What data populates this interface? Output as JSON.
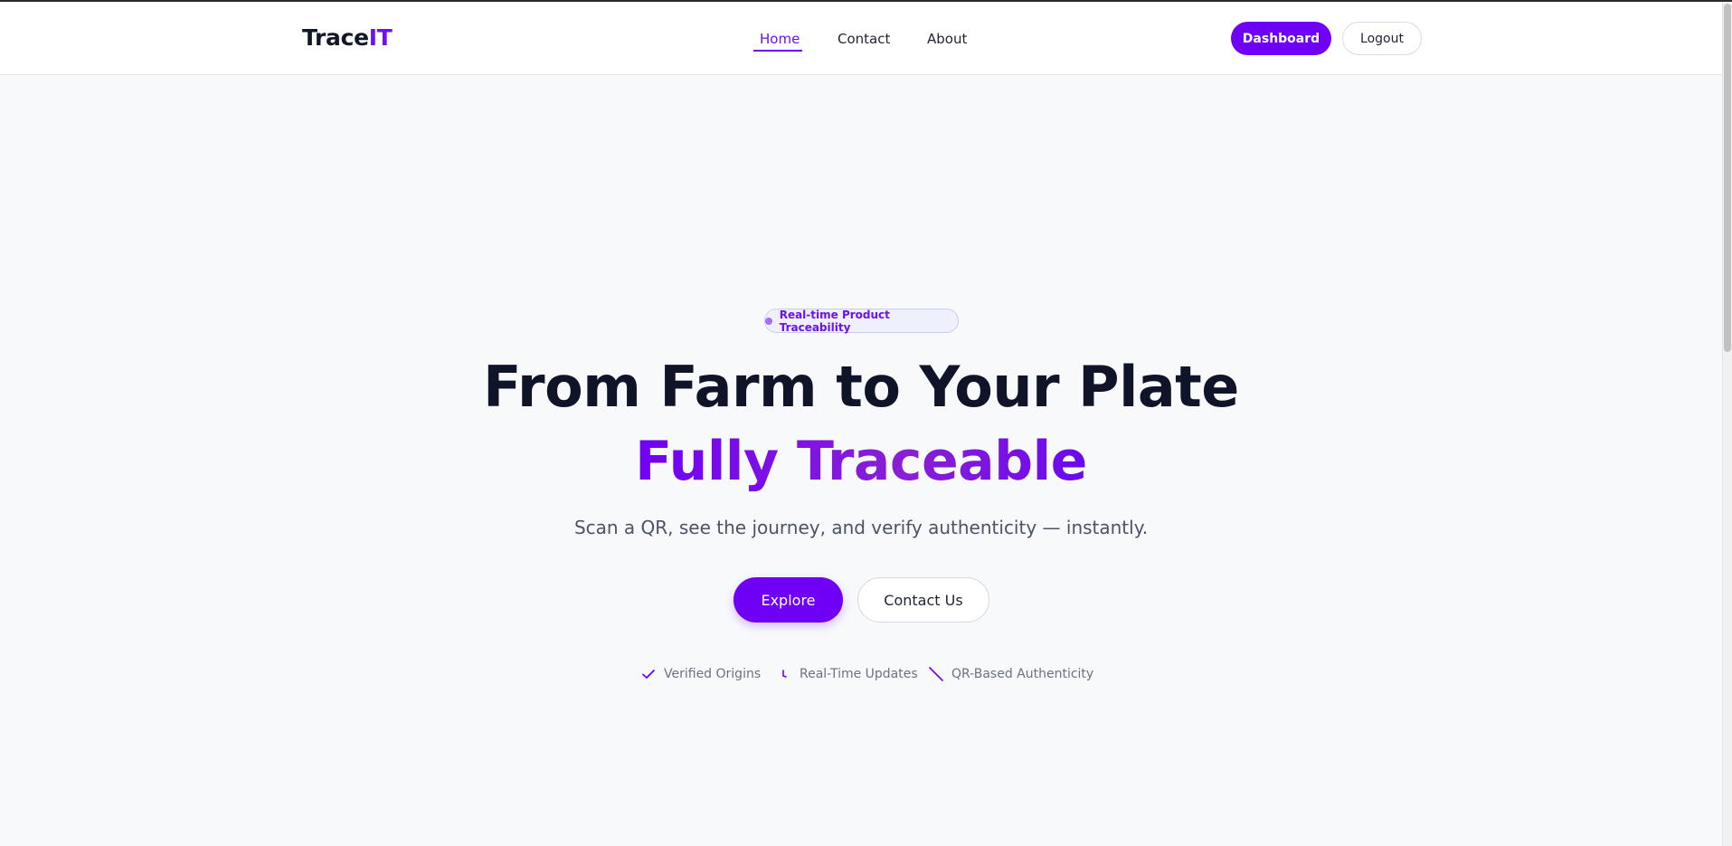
{
  "brand": {
    "name_prefix": "Trace",
    "name_suffix": "IT"
  },
  "nav": {
    "links": [
      {
        "label": "Home",
        "active": true
      },
      {
        "label": "Contact",
        "active": false
      },
      {
        "label": "About",
        "active": false
      }
    ],
    "dashboard_label": "Dashboard",
    "logout_label": "Logout"
  },
  "hero": {
    "badge": "Real-time Product Traceability",
    "title": "From Farm to Your Plate",
    "subtitle": "Fully Traceable",
    "description": "Scan a QR, see the journey, and verify authenticity — instantly.",
    "explore_label": "Explore",
    "contact_label": "Contact Us",
    "features": [
      {
        "icon": "check-icon",
        "label": "Verified Origins"
      },
      {
        "icon": "clock-icon",
        "label": "Real-Time Updates"
      },
      {
        "icon": "slash-icon",
        "label": "QR-Based Authenticity"
      }
    ]
  },
  "colors": {
    "accent": "#7000F5",
    "text_dark": "#0F1428",
    "background": "#F8F9FB"
  }
}
